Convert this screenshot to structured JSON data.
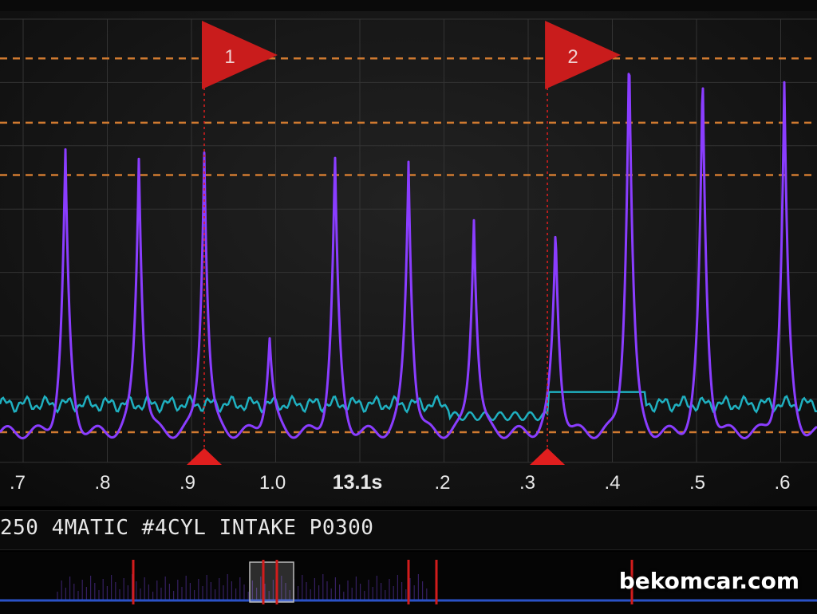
{
  "title": "250 4MATIC #4CYL INTAKE P0300",
  "watermark": "bekomcar.com",
  "time_axis": {
    "ticks": [
      ".7",
      ".8",
      ".9",
      "1.0",
      "13.1s",
      ".2",
      ".3",
      ".4",
      ".5",
      ".6"
    ],
    "current": "13.1s"
  },
  "cursors": [
    {
      "label": "1",
      "time": 12.92
    },
    {
      "label": "2",
      "time": 13.34
    }
  ],
  "colors": {
    "background": "#161616",
    "grid": "#333333",
    "purple_trace": "#8a3dff",
    "cyan_trace": "#1fb0c0",
    "threshold_lines": "#d07a30",
    "cursor": "#e01e1e"
  },
  "chart_data": {
    "type": "line",
    "x_unit": "s",
    "xlim": [
      12.67,
      13.67
    ],
    "series": [
      {
        "color": "purple",
        "peaks": [
          {
            "x": 12.75,
            "y": 0.7
          },
          {
            "x": 12.84,
            "y": 0.7
          },
          {
            "x": 12.92,
            "y": 0.71
          },
          {
            "x": 13.0,
            "y": 0.24
          },
          {
            "x": 13.08,
            "y": 0.69
          },
          {
            "x": 13.17,
            "y": 0.68
          },
          {
            "x": 13.25,
            "y": 0.55
          },
          {
            "x": 13.35,
            "y": 0.51
          },
          {
            "x": 13.44,
            "y": 0.98
          },
          {
            "x": 13.53,
            "y": 0.9
          },
          {
            "x": 13.63,
            "y": 0.87
          }
        ]
      },
      {
        "color": "cyan",
        "baseline": 0.07,
        "step_x": [
          13.34,
          13.46
        ],
        "step_y": 0.1
      }
    ],
    "threshold_lines": [
      0.93,
      0.77,
      0.64,
      0.0
    ]
  }
}
